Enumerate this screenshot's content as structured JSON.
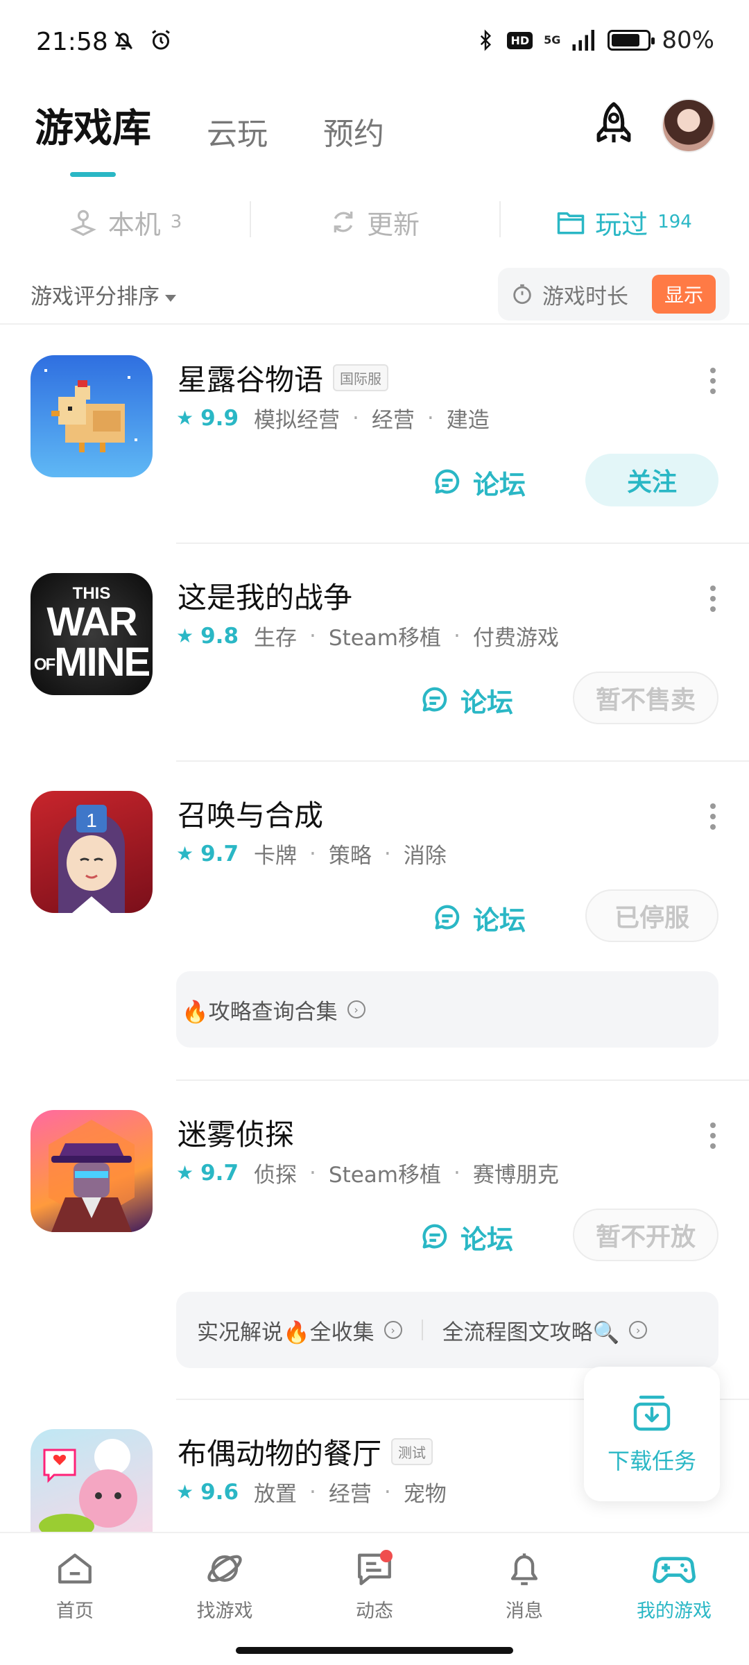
{
  "status_bar": {
    "time": "21:58",
    "network": "5G",
    "hd_label": "HD",
    "battery": "80%",
    "battery_level": 0.8
  },
  "top_tabs": [
    {
      "label": "游戏库",
      "active": true
    },
    {
      "label": "云玩",
      "active": false
    },
    {
      "label": "预约",
      "active": false
    }
  ],
  "sub_tabs": [
    {
      "label": "本机",
      "count": "3",
      "active": false
    },
    {
      "label": "更新",
      "count": "",
      "active": false
    },
    {
      "label": "玩过",
      "count": "194",
      "active": true
    }
  ],
  "sort": {
    "label": "游戏评分排序",
    "playtime_label": "游戏时长",
    "show_label": "显示"
  },
  "games": [
    {
      "title": "星露谷物语",
      "tag": "国际服",
      "score": "9.9",
      "genres": [
        "模拟经营",
        "经营",
        "建造"
      ],
      "forum_label": "论坛",
      "action_label": "关注"
    },
    {
      "title": "这是我的战争",
      "tag": "",
      "score": "9.8",
      "genres": [
        "生存",
        "Steam移植",
        "付费游戏"
      ],
      "forum_label": "论坛",
      "action_label": "暂不售卖",
      "icon_text": [
        "THIS",
        "WAR",
        "OF",
        "MINE"
      ]
    },
    {
      "title": "召唤与合成",
      "tag": "",
      "score": "9.7",
      "genres": [
        "卡牌",
        "策略",
        "消除"
      ],
      "forum_label": "论坛",
      "action_label": "已停服",
      "guides": [
        "🔥攻略查询合集"
      ],
      "icon_text": "1"
    },
    {
      "title": "迷雾侦探",
      "tag": "",
      "score": "9.7",
      "genres": [
        "侦探",
        "Steam移植",
        "赛博朋克"
      ],
      "forum_label": "论坛",
      "action_label": "暂不开放",
      "guides": [
        "实况解说🔥全收集",
        "全流程图文攻略🔍"
      ]
    },
    {
      "title": "布偶动物的餐厅",
      "tag": "测试",
      "score": "9.6",
      "genres": [
        "放置",
        "经营",
        "宠物"
      ]
    }
  ],
  "download": {
    "label": "下载任务"
  },
  "bottom_nav": [
    {
      "label": "首页",
      "icon": "home-icon",
      "active": false
    },
    {
      "label": "找游戏",
      "icon": "planet-icon",
      "active": false
    },
    {
      "label": "动态",
      "icon": "chat-icon",
      "active": false,
      "badge": true
    },
    {
      "label": "消息",
      "icon": "bell-icon",
      "active": false
    },
    {
      "label": "我的游戏",
      "icon": "gamepad-icon",
      "active": true
    }
  ],
  "colors": {
    "accent": "#2ab7c5",
    "orange": "#ff7a45",
    "badge_red": "#f04e4e"
  }
}
